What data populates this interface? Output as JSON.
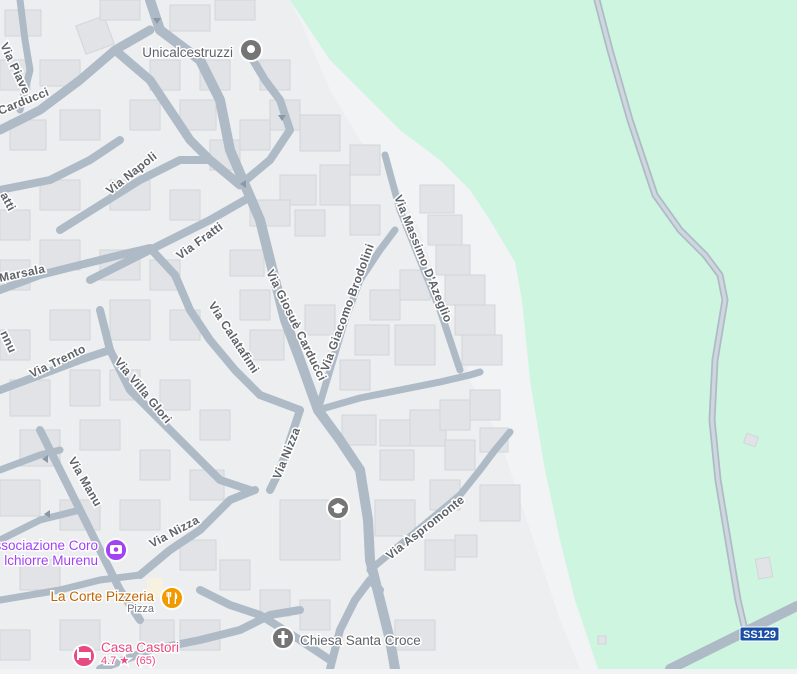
{
  "map": {
    "colors": {
      "land": "#f1f3f4",
      "park": "#cef5df",
      "road": "#aebbc7",
      "building": "#e1e3e6",
      "poi_label": "#5f6368",
      "school_marker": "#757575",
      "church_marker": "#757575",
      "food_marker": "#f29900",
      "food_label": "#c26401",
      "entertainment": "#a142f4",
      "hotel": "#e8497e",
      "highway_shield": "#1a4fa8"
    },
    "streets": [
      "Via Piave",
      "Carducci",
      "atti",
      "Via Napoli",
      "Marsala",
      "Via Fratti",
      "Via Giosuè Carducci",
      "Via Calatafimi",
      "Via Giacomo Brodolini",
      "Via Massimo D'Azeglio",
      "Via Trento",
      "Via Villa Glori",
      "Via Nizza",
      "Via Manu",
      "Via Nizza",
      "Via Aspromonte",
      "nnu"
    ],
    "pois": {
      "unicalcestruzzi": {
        "name": "Unicalcestruzzi",
        "icon": "place-pin-icon"
      },
      "school": {
        "icon": "graduation-cap-icon"
      },
      "church": {
        "name": "Chiesa Santa Croce",
        "icon": "cross-icon"
      },
      "associazione": {
        "line1": "ssociazione Coro",
        "line2": "lchiorre Murenu",
        "icon": "theater-icon"
      },
      "pizzeria": {
        "name": "La Corte Pizzeria",
        "category": "Pizza",
        "icon": "fork-knife-icon"
      },
      "casa_castori": {
        "name": "Casa Castori",
        "rating": "4.7 ★",
        "reviews": "(65)",
        "icon": "bed-icon"
      }
    },
    "highway": {
      "label": "SS129"
    }
  }
}
